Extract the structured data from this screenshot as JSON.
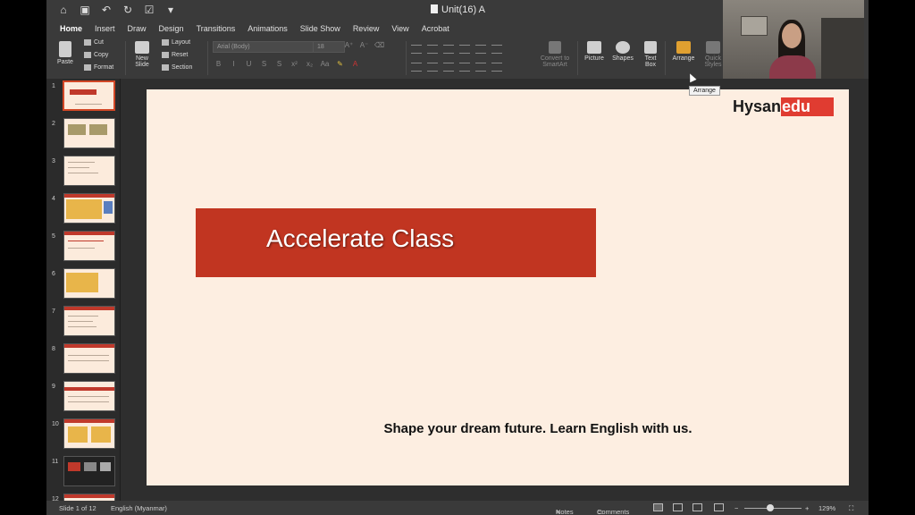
{
  "window": {
    "title": "Unit(16) A"
  },
  "ribbon_tabs": [
    "Home",
    "Insert",
    "Draw",
    "Design",
    "Transitions",
    "Animations",
    "Slide Show",
    "Review",
    "View",
    "Acrobat"
  ],
  "clipboard": {
    "paste": "Paste",
    "cut": "Cut",
    "copy": "Copy",
    "format": "Format"
  },
  "slides_group": {
    "new_slide": [
      "New",
      "Slide"
    ],
    "layout": "Layout",
    "reset": "Reset",
    "section": "Section"
  },
  "font": {
    "name": "Arial (Body)",
    "size": "18"
  },
  "insert_group": {
    "convert": [
      "Convert to",
      "SmartArt"
    ],
    "picture": "Picture",
    "shapes": "Shapes",
    "textbox": [
      "Text",
      "Box"
    ],
    "arrange": "Arrange",
    "quick_styles": [
      "Quick",
      "Styles"
    ]
  },
  "tooltip": "Arrange",
  "thumbnails": [
    "1",
    "2",
    "3",
    "4",
    "5",
    "6",
    "7",
    "8",
    "9",
    "10",
    "11",
    "12"
  ],
  "slide": {
    "brand_a": "Hysan",
    "brand_b": "edu",
    "banner_title": "Accelerate Class",
    "tagline": "Shape your dream future. Learn English with us."
  },
  "status": {
    "slide_indicator": "Slide 1 of 12",
    "language": "English (Myanmar)",
    "notes": "Notes",
    "comments": "Comments",
    "zoom": "129%"
  },
  "colors": {
    "accent": "#d24726",
    "banner": "#c13521",
    "slide_bg": "#fdeee1",
    "brand_red": "#e03c31"
  }
}
